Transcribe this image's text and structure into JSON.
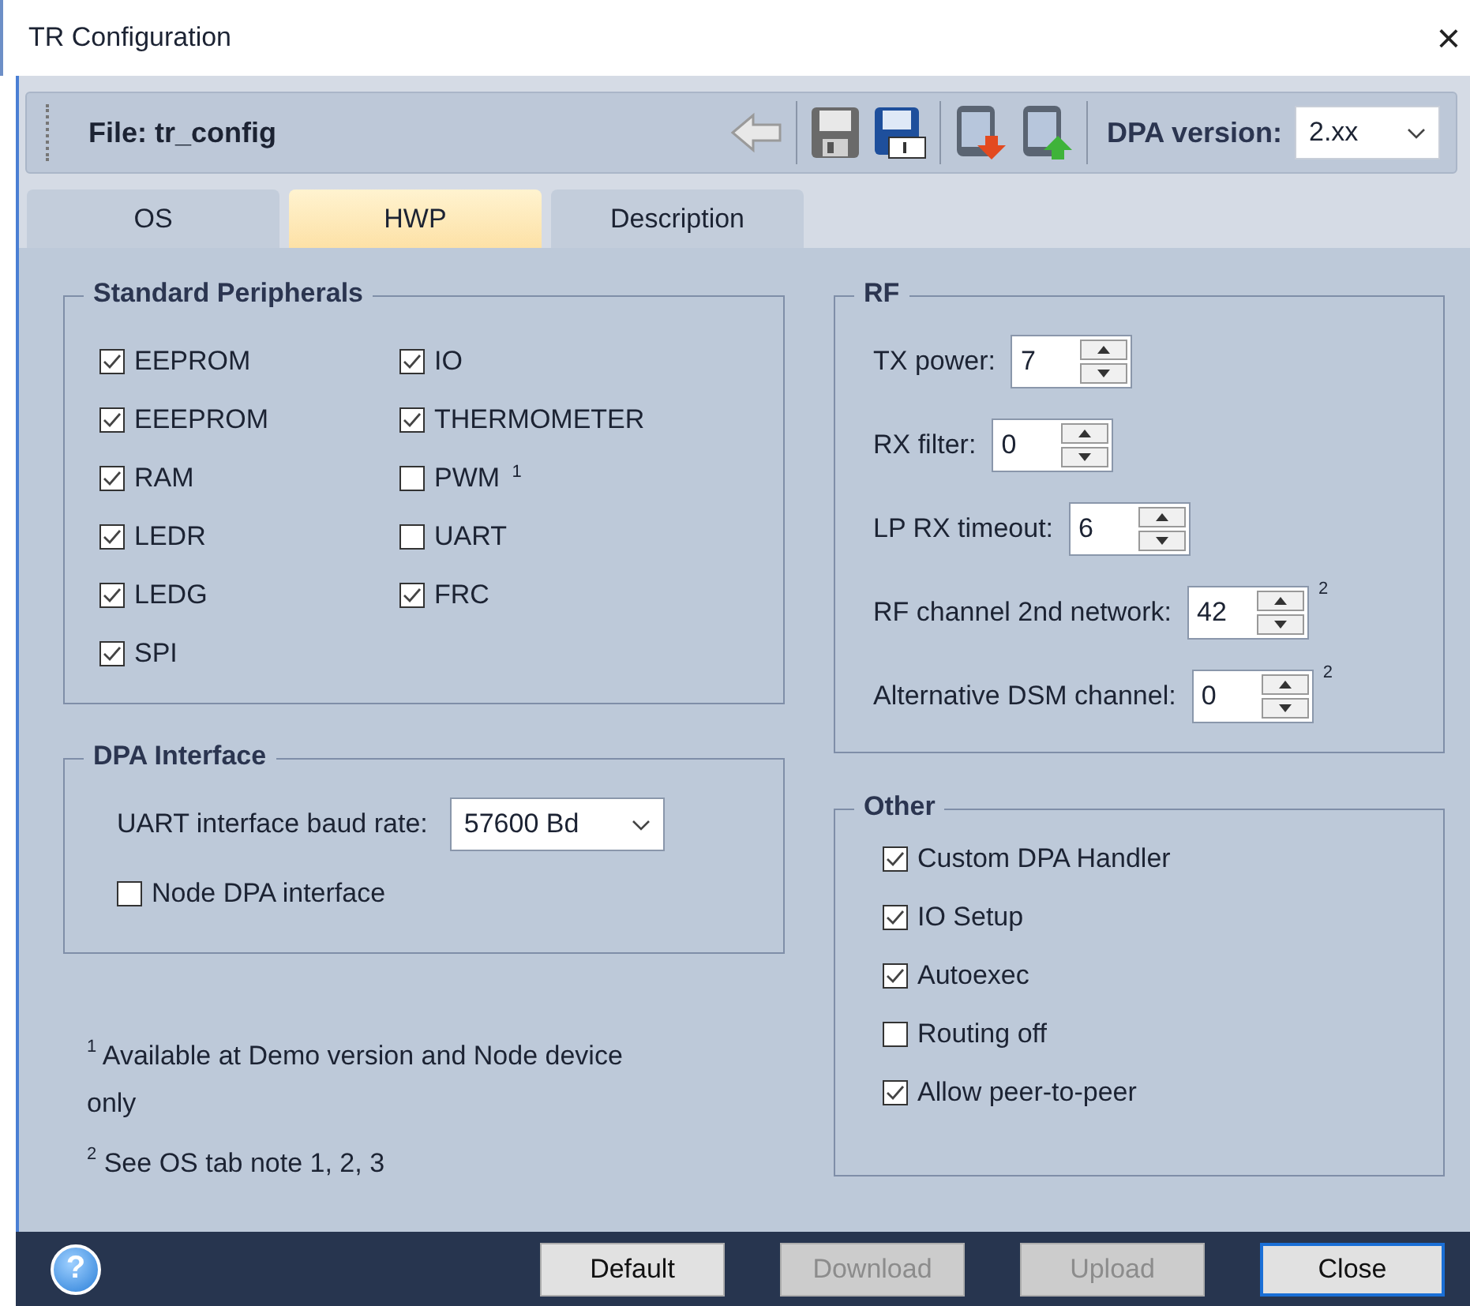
{
  "window": {
    "title": "TR Configuration",
    "close": "×"
  },
  "toolbar": {
    "file_label": "File: tr_config",
    "dpa_version_label": "DPA version:",
    "dpa_version": "2.xx"
  },
  "tabs": [
    {
      "label": "OS",
      "selected": false
    },
    {
      "label": "HWP",
      "selected": true
    },
    {
      "label": "Description",
      "selected": false
    }
  ],
  "standard_peripherals": {
    "title": "Standard Peripherals",
    "columns": [
      [
        {
          "label": "EEPROM",
          "checked": true
        },
        {
          "label": "EEEPROM",
          "checked": true
        },
        {
          "label": "RAM",
          "checked": true
        },
        {
          "label": "LEDR",
          "checked": true
        },
        {
          "label": "LEDG",
          "checked": true
        },
        {
          "label": "SPI",
          "checked": true
        }
      ],
      [
        {
          "label": "IO",
          "checked": true
        },
        {
          "label": "THERMOMETER",
          "checked": true
        },
        {
          "label": "PWM $^{1}$",
          "checked": false
        },
        {
          "label": "UART",
          "checked": false
        },
        {
          "label": "FRC",
          "checked": true
        }
      ]
    ]
  },
  "dpa_interface": {
    "title": "DPA Interface",
    "baud_label": "UART interface baud rate:",
    "baud_rate": "57600 Bd",
    "node_dpa": {
      "label": "Node DPA interface",
      "checked": false
    }
  },
  "notes": [
    "$^{1}$ Available at Demo version and Node device only",
    "$^{2}$ See OS tab note 1, 2, 3"
  ],
  "rf": {
    "title": "RF",
    "fields": [
      {
        "label": "TX power:",
        "value": "7"
      },
      {
        "label": "RX filter:",
        "value": "0"
      },
      {
        "label": "LP RX timeout:",
        "value": "6"
      },
      {
        "label": "RF channel 2nd network:",
        "value": "42",
        "note": "2"
      },
      {
        "label": "Alternative DSM channel:",
        "value": "0",
        "note": "2"
      }
    ]
  },
  "other": {
    "title": "Other",
    "items": [
      {
        "label": "Custom DPA Handler",
        "checked": true
      },
      {
        "label": "IO Setup",
        "checked": true
      },
      {
        "label": "Autoexec",
        "checked": true
      },
      {
        "label": "Routing off",
        "checked": false
      },
      {
        "label": "Allow peer-to-peer",
        "checked": true
      }
    ]
  },
  "footer": {
    "help_icon": "?",
    "buttons": [
      {
        "label": "Default",
        "disabled": false,
        "focused": false
      },
      {
        "label": "Download",
        "disabled": true,
        "focused": false
      },
      {
        "label": "Upload",
        "disabled": true,
        "focused": false
      },
      {
        "label": "Close",
        "disabled": false,
        "focused": true
      }
    ]
  }
}
